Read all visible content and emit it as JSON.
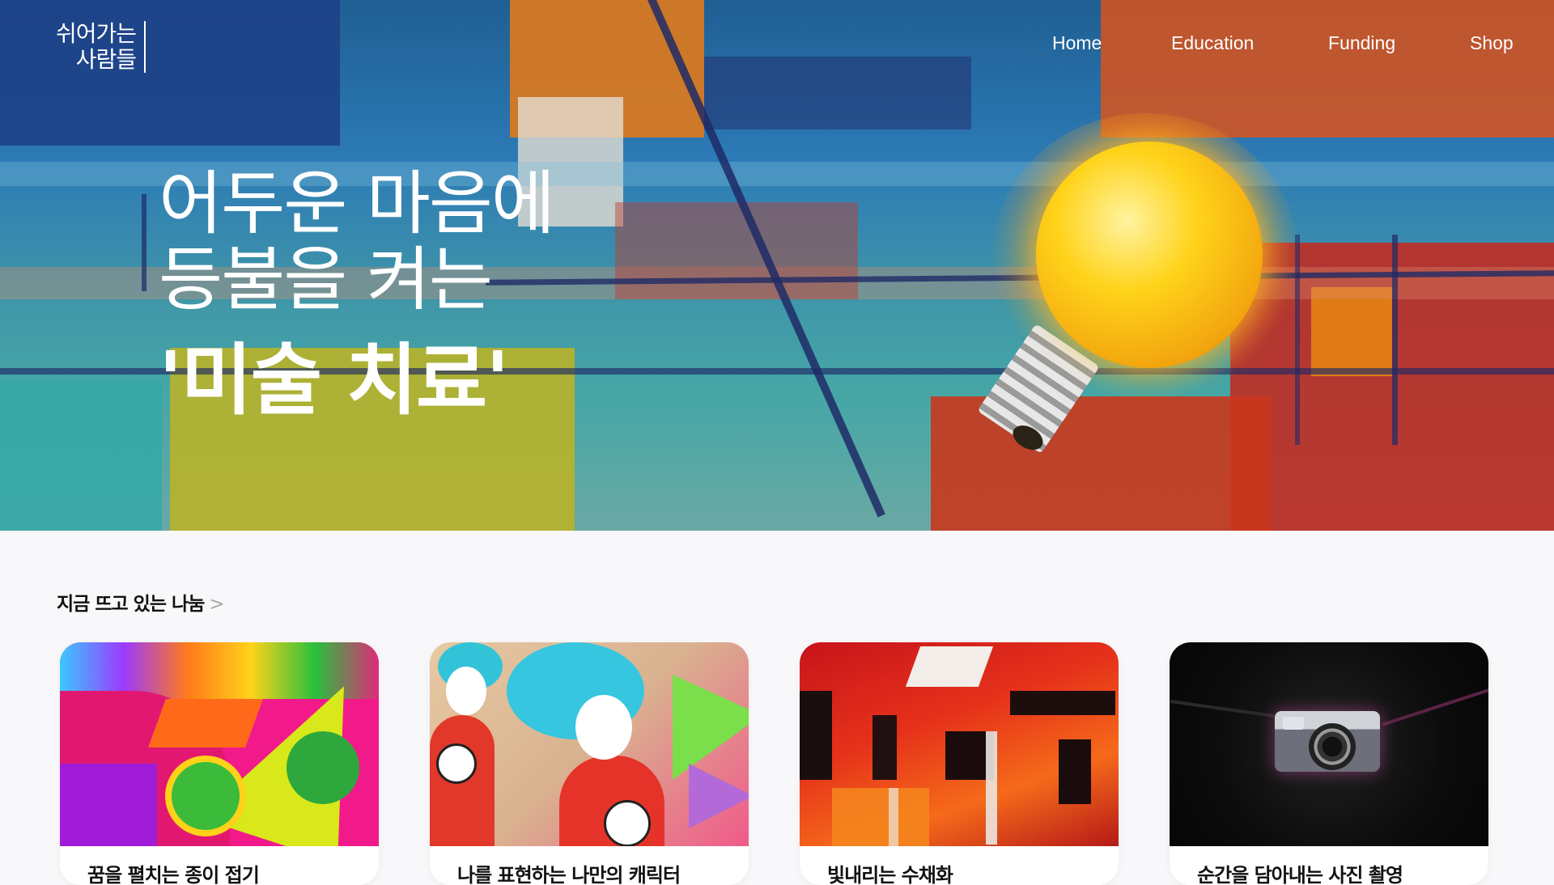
{
  "header": {
    "logo": {
      "line1": "쉬어가는",
      "line2": "사람들"
    },
    "nav": [
      "Home",
      "Education",
      "Funding",
      "Shop"
    ]
  },
  "hero": {
    "line1": "어두운 마음에",
    "line2": "등불을 켜는",
    "highlight": "'미술 치료'"
  },
  "section": {
    "title": "지금 뜨고 있는 나눔",
    "chevron": ">",
    "cards": [
      {
        "title": "꿈을 펼치는 종이 접기"
      },
      {
        "title": "나를 표현하는 나만의 캐릭터"
      },
      {
        "title": "빛내리는 수채화"
      },
      {
        "title": "순간을 담아내는 사진 촬영"
      }
    ]
  }
}
